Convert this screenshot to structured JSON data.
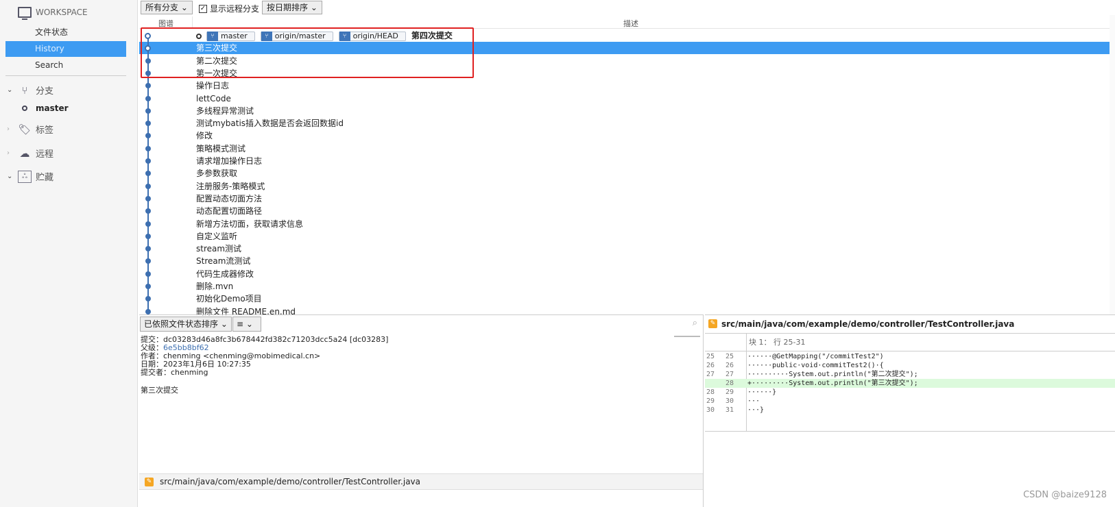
{
  "sidebar": {
    "workspace": "WORKSPACE",
    "items": [
      {
        "label": "文件状态"
      },
      {
        "label": "History"
      },
      {
        "label": "Search"
      }
    ],
    "groups": {
      "branches": "分支",
      "branch_master": "master",
      "tags": "标签",
      "remotes": "远程",
      "stashes": "贮藏"
    }
  },
  "toolbar": {
    "branch_filter": "所有分支",
    "show_remote": "显示远程分支",
    "show_remote_checked": true,
    "sort": "按日期排序"
  },
  "columns": {
    "graph": "图谱",
    "desc": "描述"
  },
  "head_refs": [
    "master",
    "origin/master",
    "origin/HEAD"
  ],
  "commits": [
    "第四次提交",
    "第三次提交",
    "第二次提交",
    "第一次提交",
    "操作日志",
    "lettCode",
    "多线程异常测试",
    "测试mybatis插入数据是否会返回数据id",
    "修改",
    "策略模式测试",
    "请求增加操作日志",
    "多参数获取",
    "注册服务-策略模式",
    "配置动态切面方法",
    "动态配置切面路径",
    "新增方法切面，获取请求信息",
    "自定义监听",
    "stream测试",
    "Stream流测试",
    "代码生成器修改",
    "删除.mvn",
    "初始化Demo项目",
    "删除文件 README.en.md"
  ],
  "selected_index": 1,
  "details": {
    "sort": "已依照文件状态排序",
    "view": "≡",
    "commit_label": "提交：",
    "commit": "dc03283d46a8fc3b678442fd382c71203dcc5a24 [dc03283]",
    "parent_label": "父级：",
    "parent": "6e5bb8bf62",
    "author_label": "作者：",
    "author": "chenming <chenming@mobimedical.cn>",
    "date_label": "日期：",
    "date": "2023年1月6日 10:27:35",
    "committer_label": "提交者：",
    "committer": "chenming",
    "message": "第三次提交",
    "file": "src/main/java/com/example/demo/controller/TestController.java"
  },
  "diff": {
    "file": "src/main/java/com/example/demo/controller/TestController.java",
    "hunk": "块 1： 行 25-31",
    "lines": [
      {
        "o": "25",
        "n": "25",
        "t": "······@GetMapping(\"/commitTest2\")"
      },
      {
        "o": "26",
        "n": "26",
        "t": "······public·void·commitTest2()·{"
      },
      {
        "o": "27",
        "n": "27",
        "t": "··········System.out.println(\"第二次提交\");"
      },
      {
        "o": "",
        "n": "28",
        "t": "+·········System.out.println(\"第三次提交\");",
        "add": true
      },
      {
        "o": "28",
        "n": "29",
        "t": "······}"
      },
      {
        "o": "29",
        "n": "30",
        "t": "···"
      },
      {
        "o": "30",
        "n": "31",
        "t": "···}"
      }
    ]
  },
  "watermark": "CSDN @baize9128",
  "colors": {
    "accent": "#3d9bf2",
    "graph": "#3d6fb0",
    "highlight": "#e02020",
    "added": "#dcfadc"
  }
}
